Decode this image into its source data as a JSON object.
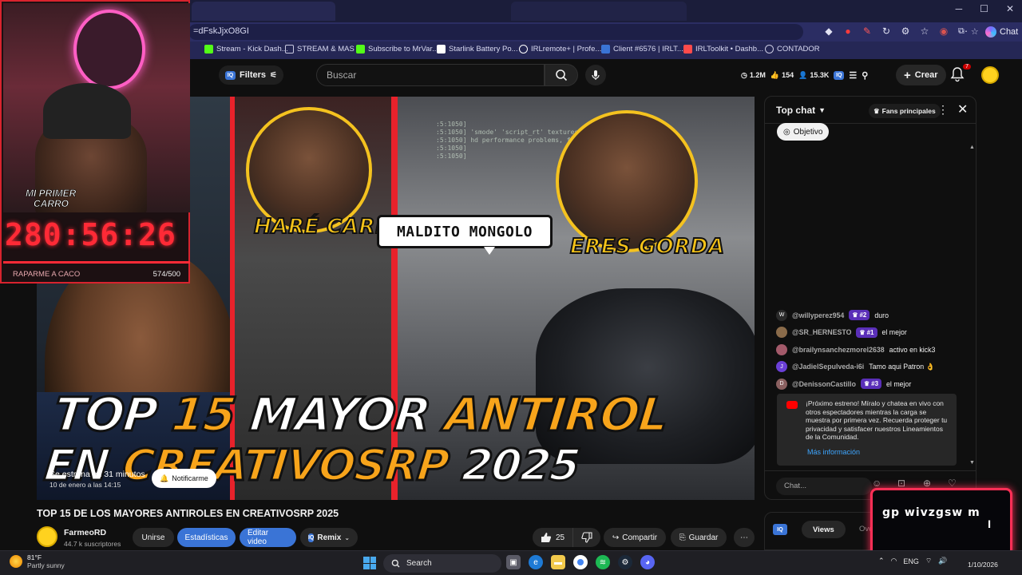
{
  "browser": {
    "url": "=dFskJjxO8GI",
    "chat_button_label": "Chat",
    "window_controls": [
      "─",
      "☐",
      "✕"
    ],
    "bookmarks": [
      {
        "label": "Stream - Kick Dash...",
        "color": "#53fc18"
      },
      {
        "label": "STREAM & MAS",
        "color": "#c9c9e0"
      },
      {
        "label": "Subscribe to MrVar...",
        "color": "#53fc18"
      },
      {
        "label": "Starlink Battery Po...",
        "color": "#ffffff"
      },
      {
        "label": "IRLremote+ | Profe...",
        "color": "#ffffff"
      },
      {
        "label": "Client #6576 | IRLT...",
        "color": "#3a74d6"
      },
      {
        "label": "IRLToolkit • Dashb...",
        "color": "#ff4b4b"
      },
      {
        "label": "CONTADOR",
        "color": "#c9c9e0"
      }
    ]
  },
  "youtube_header": {
    "filters_label": "Filters",
    "search_placeholder": "Buscar",
    "stats": {
      "views": "1.2M",
      "likes": "154",
      "subs": "15.3K"
    },
    "create_label": "Crear",
    "notification_count": "7"
  },
  "stream_overlay": {
    "first_car_line1": "MI PRIMER",
    "first_car_line2": "CARRO",
    "timer": "280:56:26",
    "goal_label": "RAPARME A CACO",
    "goal_progress": "574/500",
    "goal_fraction": 1.0
  },
  "thumbnail": {
    "caption_left": "HARÉ CARKILL",
    "caption_center": "MALDITO MONGOLO",
    "caption_right": "ERES GORDA",
    "title_line1_white": "TOP",
    "title_line1_orange": "15",
    "title_line1_white2": "MAYOR",
    "title_line1_orange2": "ANTIROL",
    "title_line2_white": "EN",
    "title_line2_orange": "CREATIVOSRP",
    "title_line2_white2": "2025",
    "code_lines": [
      ":5:1050]",
      ":5:1050] 'smode' 'script_rt' textures should",
      ":5:1050] hd performance problems, fix or update the tool used",
      ":5:1050]",
      ":5:1050]"
    ]
  },
  "premiere": {
    "line1": "Se estrena en 31 minutos",
    "line2": "10 de enero a las 14:15",
    "notify_label": "Notificarme"
  },
  "chat": {
    "header_title": "Top chat",
    "fans_label": "Fans principales",
    "objective_label": "Objetivo",
    "messages": [
      {
        "initial": "W",
        "avatar_color": "#2a2a2a",
        "user": "@willyperez954",
        "rank": "#2",
        "text": "duro"
      },
      {
        "initial": "",
        "avatar_color": "#8a6b4a",
        "user": "@SR_HERNESTO",
        "rank": "#1",
        "text": "el mejor"
      },
      {
        "initial": "",
        "avatar_color": "#a35a6a",
        "user": "@brailynsanchezmorel2638",
        "rank": "",
        "text": "activo en kick3"
      },
      {
        "initial": "J",
        "avatar_color": "#6a3fd6",
        "user": "@JadielSepulveda-i6i",
        "rank": "",
        "text": "Tamo aqui Patron 👌"
      },
      {
        "initial": "D",
        "avatar_color": "#8a6060",
        "user": "@DenissonCastillo",
        "rank": "#3",
        "text": "el mejor"
      }
    ],
    "notice_text": "¡Próximo estreno! Míralo y chatea en vivo con otros espectadores mientras la carga se muestra por primera vez. Recuerda proteger tu privacidad y satisfacer nuestros Lineamientos de la Comunidad.",
    "notice_link": "Más información",
    "input_placeholder": "Chat..."
  },
  "video_info": {
    "title": "TOP 15 DE LOS MAYORES ANTIROLES EN CREATIVOSRP 2025",
    "channel_name": "FarmeoRD",
    "subscribers": "44.7 k suscriptores",
    "join_label": "Unirse",
    "stats_label": "Estadísticas",
    "edit_label": "Editar video",
    "remix_label": "Remix",
    "likes": "25",
    "share_label": "Compartir",
    "save_label": "Guardar"
  },
  "side_panel": {
    "views_tab": "Views",
    "next_tab_partial": "Ove"
  },
  "corner_widget": {
    "text_line1": "gp  wivzgsw  m",
    "text_line2": "l"
  },
  "taskbar": {
    "temperature": "81°F",
    "condition": "Partly sunny",
    "search_label": "Search",
    "language": "ENG",
    "date": "1/10/2026"
  }
}
